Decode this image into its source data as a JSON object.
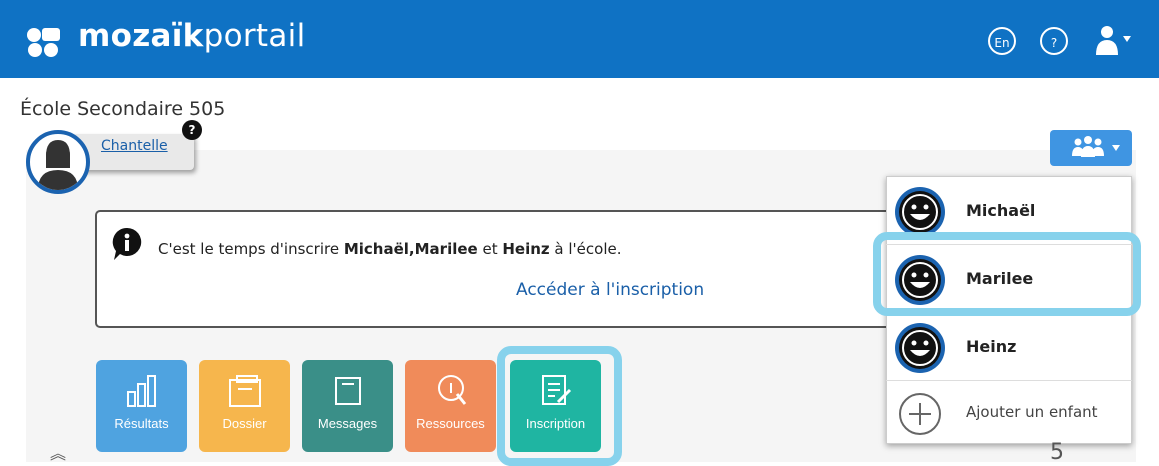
{
  "header": {
    "logo_bold": "mozaïk",
    "logo_light": "portail",
    "lang_button": "En",
    "help_button": "?",
    "user_icon": "user-menu-icon"
  },
  "school_name": "École Secondaire 505",
  "student": {
    "name": "Chantelle",
    "badge": "?"
  },
  "notice": {
    "text_prefix": "C'est le temps d'inscrire ",
    "names": "Michaël,Marilee",
    "text_mid": " et ",
    "name3": "Heinz",
    "text_suffix": " à l'école.",
    "link": "Accéder à l'inscription"
  },
  "family_button": {
    "icon": "family-icon"
  },
  "dropdown": {
    "items": [
      {
        "label": "Michaël"
      },
      {
        "label": "Marilee"
      },
      {
        "label": "Heinz"
      },
      {
        "label": "Ajouter un enfant"
      }
    ]
  },
  "tiles": [
    {
      "label": "Résultats",
      "color": "#4fa3e0"
    },
    {
      "label": "Dossier",
      "color": "#f6b64d"
    },
    {
      "label": "Messages",
      "color": "#3a8f88"
    },
    {
      "label": "Ressources",
      "color": "#f08b5a"
    },
    {
      "label": "Inscription",
      "color": "#1fb5a2"
    }
  ],
  "collapse_glyph": "︽",
  "corner_number": "5",
  "colors": {
    "header_bg": "#0f72c4",
    "highlight": "#87d2ec",
    "link": "#1a5fa8"
  }
}
